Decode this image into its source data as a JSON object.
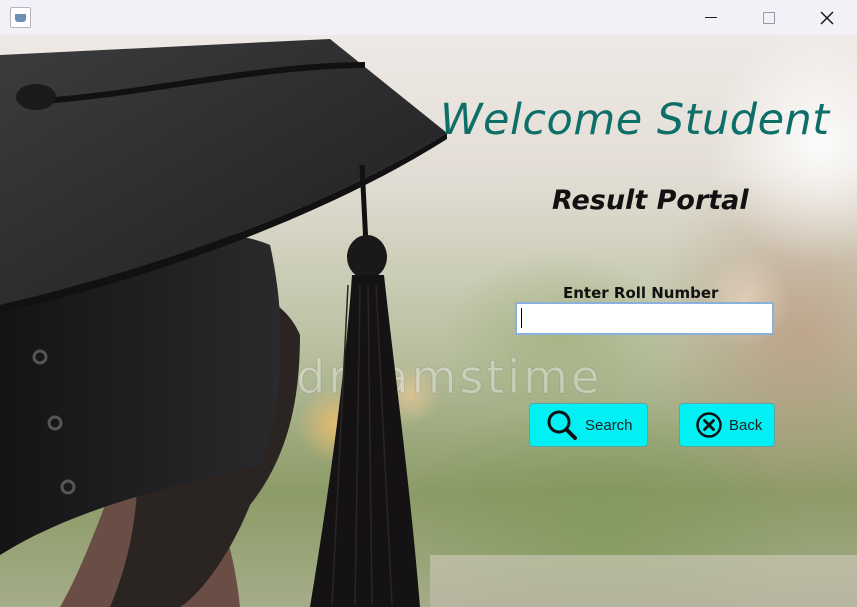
{
  "window": {
    "title": "",
    "controls": [
      "minimize",
      "maximize",
      "close"
    ]
  },
  "header": {
    "welcome": "Welcome Student",
    "subtitle": "Result Portal"
  },
  "form": {
    "roll_label": "Enter Roll Number",
    "roll_value": "",
    "roll_placeholder": ""
  },
  "buttons": {
    "search_label": "Search",
    "back_label": "Back"
  },
  "background": {
    "watermark": "dreamstime"
  },
  "icons": {
    "app": "java-app-icon",
    "minimize": "minimize-icon",
    "maximize": "maximize-icon",
    "close": "close-icon",
    "search": "search-icon",
    "back": "close-circle-icon"
  },
  "colors": {
    "welcome_text": "#0e6f69",
    "button_bg": "#00f0f3",
    "input_border": "#8ab1dc"
  }
}
